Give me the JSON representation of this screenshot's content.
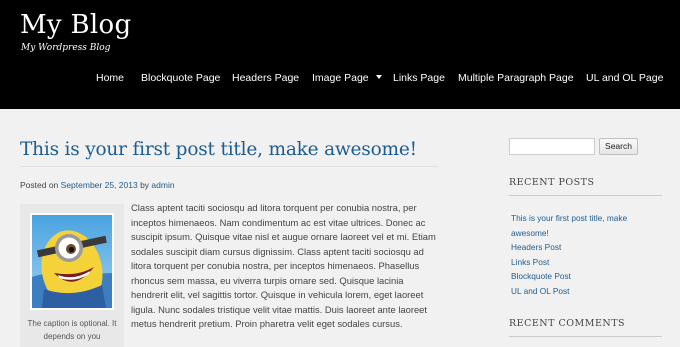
{
  "site": {
    "title": "My Blog",
    "tagline": "My Wordpress Blog"
  },
  "nav": {
    "items": [
      {
        "label": "Home"
      },
      {
        "label": "Blockquote Page"
      },
      {
        "label": "Headers Page"
      },
      {
        "label": "Image Page",
        "has_submenu": true
      },
      {
        "label": "Links Page"
      },
      {
        "label": "Multiple Paragraph Page"
      },
      {
        "label": "UL and OL Page"
      }
    ]
  },
  "post": {
    "title": "This is your first post title, make awesome!",
    "meta": {
      "prefix": "Posted on",
      "date": "September 25, 2013",
      "by": "by",
      "author": "admin"
    },
    "image": {
      "icon": "minion-image",
      "caption": "The caption is optional. It depends on you"
    },
    "body": "Class aptent taciti sociosqu ad litora torquent per conubia nostra, per inceptos himenaeos. Nam condimentum ac est vitae ultrices. Donec ac suscipit ipsum. Quisque vitae nisl et augue ornare laoreet vel et mi. Etiam sodales suscipit diam cursus dignissim. Class aptent taciti sociosqu ad litora torquent per conubia nostra, per inceptos himenaeos. Phasellus rhoncus sem massa, eu viverra turpis ornare sed. Quisque lacinia hendrerit elit, vel sagittis tortor. Quisque in vehicula lorem, eget laoreet ligula. Nunc sodales tristique velit vitae mattis. Duis laoreet ante laoreet metus hendrerit pretium. Proin pharetra velit eget sodales cursus."
  },
  "sidebar": {
    "search": {
      "value": "",
      "button_label": "Search"
    },
    "recent_posts": {
      "title": "RECENT POSTS",
      "items": [
        "This is your first post title, make awesome!",
        "Headers Post",
        "Links Post",
        "Blockquote Post",
        "UL and OL Post"
      ]
    },
    "recent_comments": {
      "title": "RECENT COMMENTS"
    }
  },
  "colors": {
    "header_bg": "#000000",
    "link": "#1f5c8e",
    "page_bg": "#f1f1f1"
  }
}
